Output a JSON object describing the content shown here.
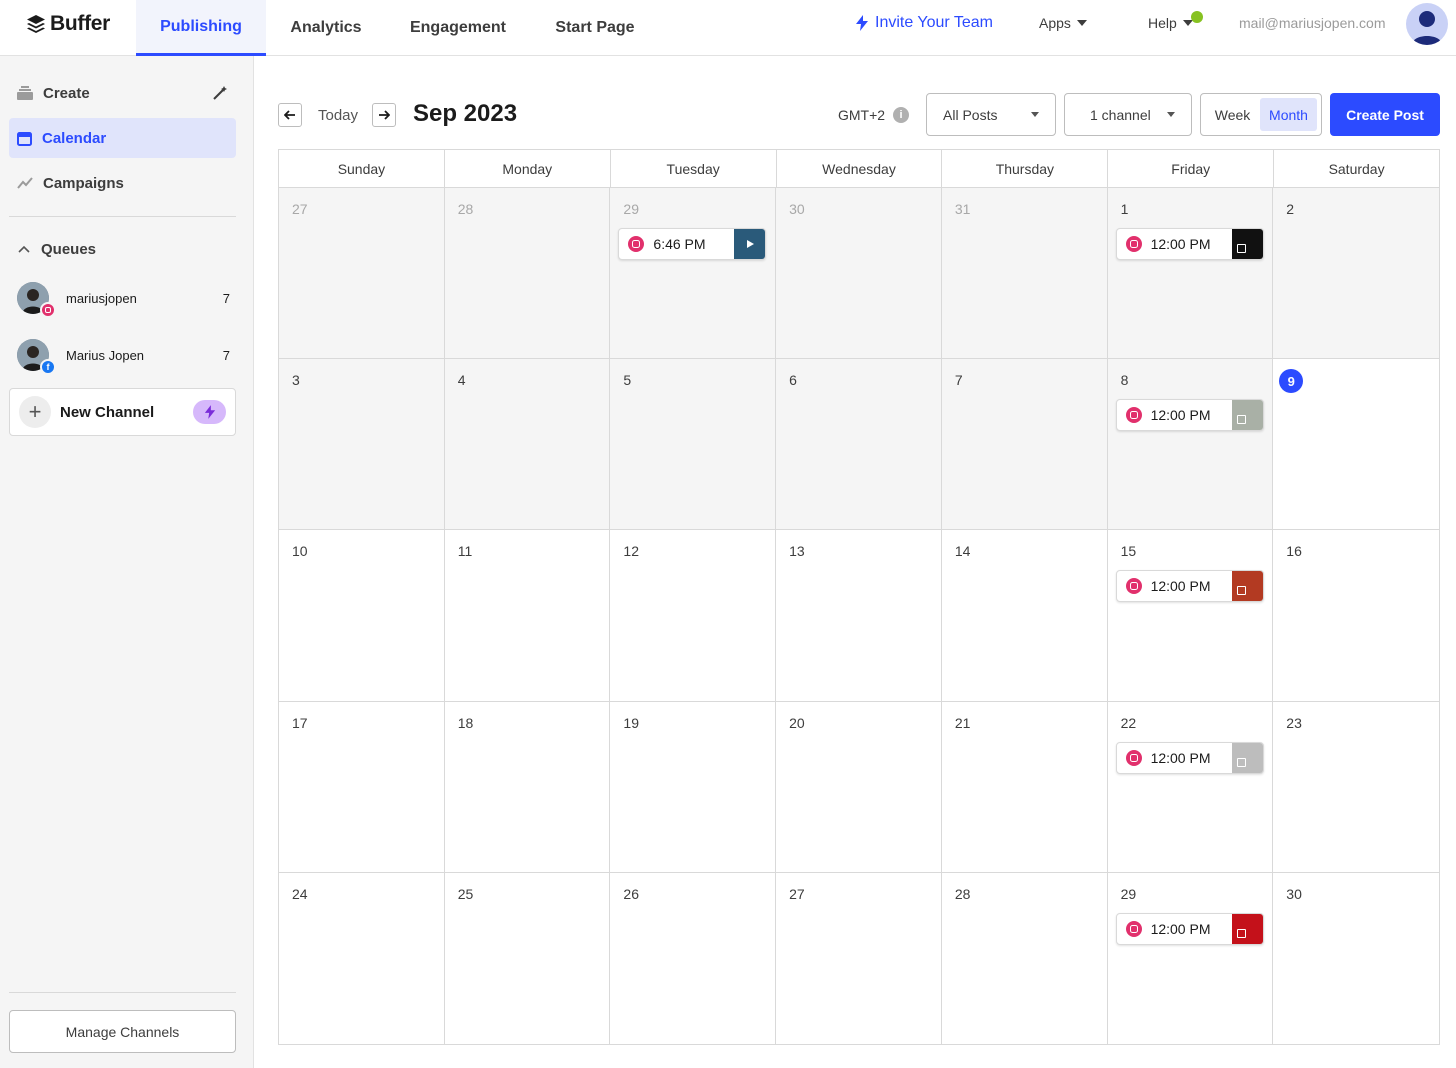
{
  "brand": {
    "name": "Buffer",
    "accent": "#2c4bff"
  },
  "nav": {
    "tabs": [
      {
        "label": "Publishing",
        "active": true
      },
      {
        "label": "Analytics"
      },
      {
        "label": "Engagement"
      },
      {
        "label": "Start Page"
      }
    ],
    "invite": "Invite Your Team",
    "apps": "Apps",
    "help": "Help",
    "email": "mail@mariusjopen.com"
  },
  "sidebar": {
    "items": [
      {
        "label": "Create",
        "icon": "stack-icon"
      },
      {
        "label": "Calendar",
        "icon": "calendar-icon",
        "active": true
      },
      {
        "label": "Campaigns",
        "icon": "trend-icon"
      }
    ],
    "queues_label": "Queues",
    "queues": [
      {
        "name": "mariusjopen",
        "count": "7",
        "network": "instagram"
      },
      {
        "name": "Marius Jopen",
        "count": "7",
        "network": "facebook"
      }
    ],
    "new_channel": "New Channel",
    "manage_channels": "Manage Channels"
  },
  "toolbar": {
    "today": "Today",
    "month_title": "Sep 2023",
    "timezone": "GMT+2",
    "filter": "All Posts",
    "channels": "1 channel",
    "view_week": "Week",
    "view_month": "Month",
    "create_post": "Create Post"
  },
  "calendar": {
    "weekdays": [
      "Sunday",
      "Monday",
      "Tuesday",
      "Wednesday",
      "Thursday",
      "Friday",
      "Saturday"
    ],
    "today_day": "9",
    "days": [
      {
        "d": "27",
        "other": true,
        "past": true
      },
      {
        "d": "28",
        "other": true,
        "past": true
      },
      {
        "d": "29",
        "other": true,
        "past": true,
        "post": {
          "time": "6:46 PM",
          "thumb": "#2a5a7a",
          "video": true
        }
      },
      {
        "d": "30",
        "other": true,
        "past": true
      },
      {
        "d": "31",
        "other": true,
        "past": true
      },
      {
        "d": "1",
        "past": true,
        "post": {
          "time": "12:00 PM",
          "thumb": "#111111"
        }
      },
      {
        "d": "2",
        "past": true
      },
      {
        "d": "3",
        "past": true
      },
      {
        "d": "4",
        "past": true
      },
      {
        "d": "5",
        "past": true
      },
      {
        "d": "6",
        "past": true
      },
      {
        "d": "7",
        "past": true
      },
      {
        "d": "8",
        "past": true,
        "post": {
          "time": "12:00 PM",
          "thumb": "#a9b0a6"
        }
      },
      {
        "d": "9",
        "today": true
      },
      {
        "d": "10"
      },
      {
        "d": "11"
      },
      {
        "d": "12"
      },
      {
        "d": "13"
      },
      {
        "d": "14"
      },
      {
        "d": "15",
        "post": {
          "time": "12:00 PM",
          "thumb": "#b33a22"
        }
      },
      {
        "d": "16"
      },
      {
        "d": "17"
      },
      {
        "d": "18"
      },
      {
        "d": "19"
      },
      {
        "d": "20"
      },
      {
        "d": "21"
      },
      {
        "d": "22",
        "post": {
          "time": "12:00 PM",
          "thumb": "#bdbdbd"
        }
      },
      {
        "d": "23"
      },
      {
        "d": "24"
      },
      {
        "d": "25"
      },
      {
        "d": "26"
      },
      {
        "d": "27"
      },
      {
        "d": "28"
      },
      {
        "d": "29",
        "post": {
          "time": "12:00 PM",
          "thumb": "#c4111a"
        }
      },
      {
        "d": "30"
      }
    ]
  }
}
